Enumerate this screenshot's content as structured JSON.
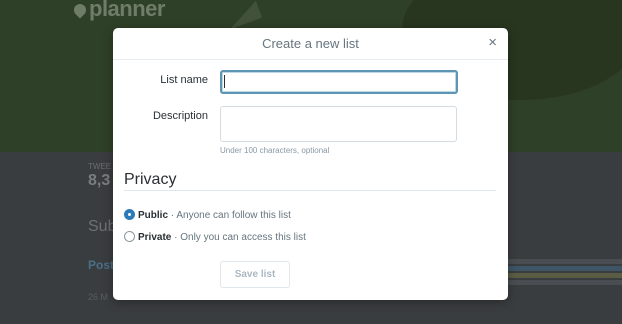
{
  "background": {
    "logo_text": "planner",
    "stat_label": "TWEE",
    "stat_value": "8,3",
    "subtitle": "Sub",
    "link": "Post",
    "small": "26 M"
  },
  "modal": {
    "title": "Create a new list",
    "close_label": "×",
    "name_label": "List name",
    "name_value": "",
    "description_label": "Description",
    "description_value": "",
    "description_hint": "Under 100 characters, optional",
    "privacy_heading": "Privacy",
    "options": [
      {
        "label": "Public",
        "description": " · Anyone can follow this list",
        "selected": true
      },
      {
        "label": "Private",
        "description": " · Only you can access this list",
        "selected": false
      }
    ],
    "save_label": "Save list"
  },
  "colors": {
    "accent": "#2b7bb9",
    "focus_border": "#5d95b3",
    "muted_text": "#66757f"
  },
  "icons": {
    "close": "close-icon",
    "logo": "pin-icon",
    "background_graphic": "paper-plane-icon"
  }
}
